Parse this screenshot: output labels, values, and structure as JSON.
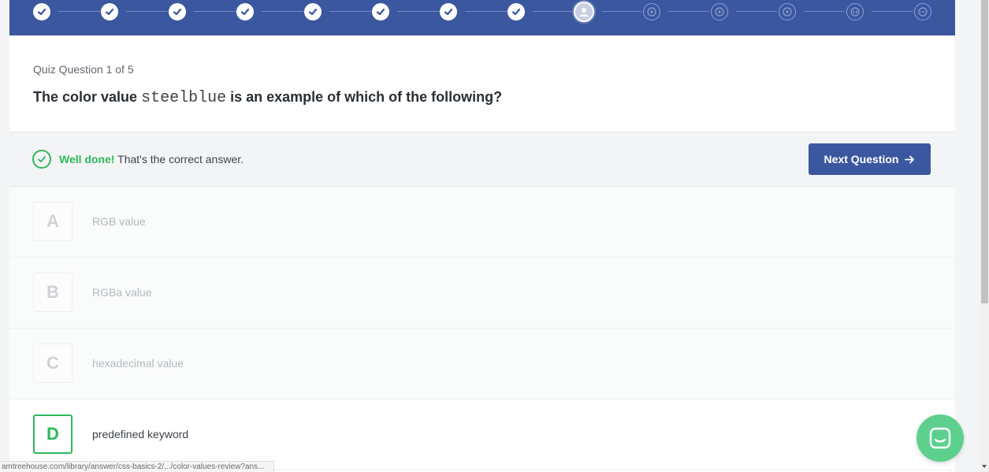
{
  "progress": {
    "steps": [
      {
        "state": "done",
        "icon": "check-icon"
      },
      {
        "state": "done",
        "icon": "check-icon"
      },
      {
        "state": "done",
        "icon": "check-icon"
      },
      {
        "state": "done",
        "icon": "check-icon"
      },
      {
        "state": "done",
        "icon": "check-icon"
      },
      {
        "state": "done",
        "icon": "check-icon"
      },
      {
        "state": "done",
        "icon": "check-icon"
      },
      {
        "state": "done",
        "icon": "check-icon"
      },
      {
        "state": "current",
        "icon": "user-icon"
      },
      {
        "state": "todo",
        "icon": "play-icon"
      },
      {
        "state": "todo",
        "icon": "play-icon"
      },
      {
        "state": "todo",
        "icon": "play-icon"
      },
      {
        "state": "todo",
        "icon": "code-icon"
      },
      {
        "state": "todo",
        "icon": "more-icon"
      }
    ]
  },
  "quiz": {
    "counter": "Quiz Question 1 of 5",
    "question_before": "The color value",
    "question_code": "steelblue",
    "question_after": "is an example of which of the following?"
  },
  "feedback": {
    "well_done": "Well done!",
    "message": "That's the correct answer.",
    "next_label": "Next Question"
  },
  "answers": [
    {
      "letter": "A",
      "text": "RGB value",
      "correct": false
    },
    {
      "letter": "B",
      "text": "RGBa value",
      "correct": false
    },
    {
      "letter": "C",
      "text": "hexadecimal value",
      "correct": false
    },
    {
      "letter": "D",
      "text": "predefined keyword",
      "correct": true
    }
  ],
  "status_bar": {
    "url": "amtreehouse.com/library/answer/css-basics-2/.../color-values-review?ans..."
  },
  "colors": {
    "brand_blue": "#3b57a0",
    "success_green": "#2eb85c",
    "chat_green": "#5dd08e"
  }
}
